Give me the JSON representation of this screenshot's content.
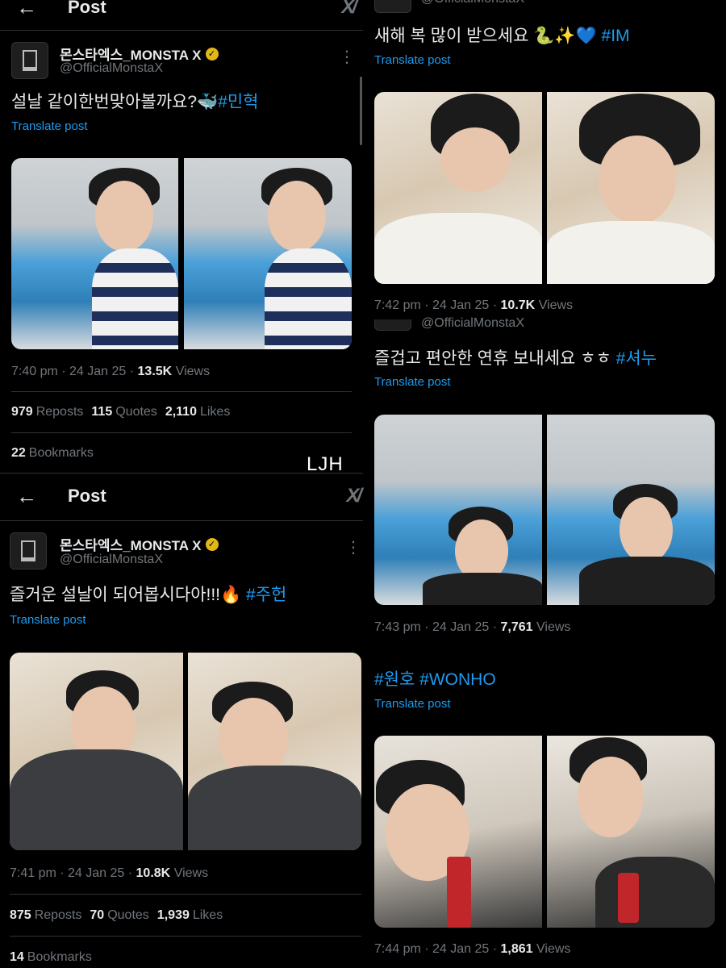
{
  "header": {
    "title": "Post"
  },
  "account": {
    "name": "몬스타엑스_MONSTA X",
    "handle": "@OfficialMonstaX"
  },
  "translate_label": "Translate post",
  "watermark": "LJH",
  "left_posts": [
    {
      "text": "설날 같이한번맞아볼까요?🐳",
      "tag": "#민혁",
      "time": "7:40 pm · 24 Jan 25 · ",
      "views_count": "13.5K",
      "views_label": "Views",
      "reposts_count": "979",
      "reposts_label": "Reposts",
      "quotes_count": "115",
      "quotes_label": "Quotes",
      "likes_count": "2,110",
      "likes_label": "Likes",
      "bookmarks_count": "22",
      "bookmarks_label": "Bookmarks"
    },
    {
      "text": "즐거운 설날이 되어봅시다아!!!🔥",
      "tag": "#주헌",
      "time": "7:41 pm · 24 Jan 25 · ",
      "views_count": "10.8K",
      "views_label": "Views",
      "reposts_count": "875",
      "reposts_label": "Reposts",
      "quotes_count": "70",
      "quotes_label": "Quotes",
      "likes_count": "1,939",
      "likes_label": "Likes",
      "bookmarks_count": "14",
      "bookmarks_label": "Bookmarks"
    }
  ],
  "right_posts": [
    {
      "text": "새해 복 많이 받으세요 🐍✨💙",
      "tag": "#IM",
      "time": "7:42 pm · 24 Jan 25 · ",
      "views_count": "10.7K",
      "views_label": "Views"
    },
    {
      "text": "즐겁고 편안한 연휴 보내세요 ㅎㅎ",
      "tag": "#셔누",
      "time": "7:43 pm · 24 Jan 25 · ",
      "views_count": "7,761",
      "views_label": "Views"
    },
    {
      "text": "",
      "tag": "#원호 #WONHO",
      "time": "7:44 pm · 24 Jan 25 · ",
      "views_count": "1,861",
      "views_label": "Views"
    }
  ]
}
